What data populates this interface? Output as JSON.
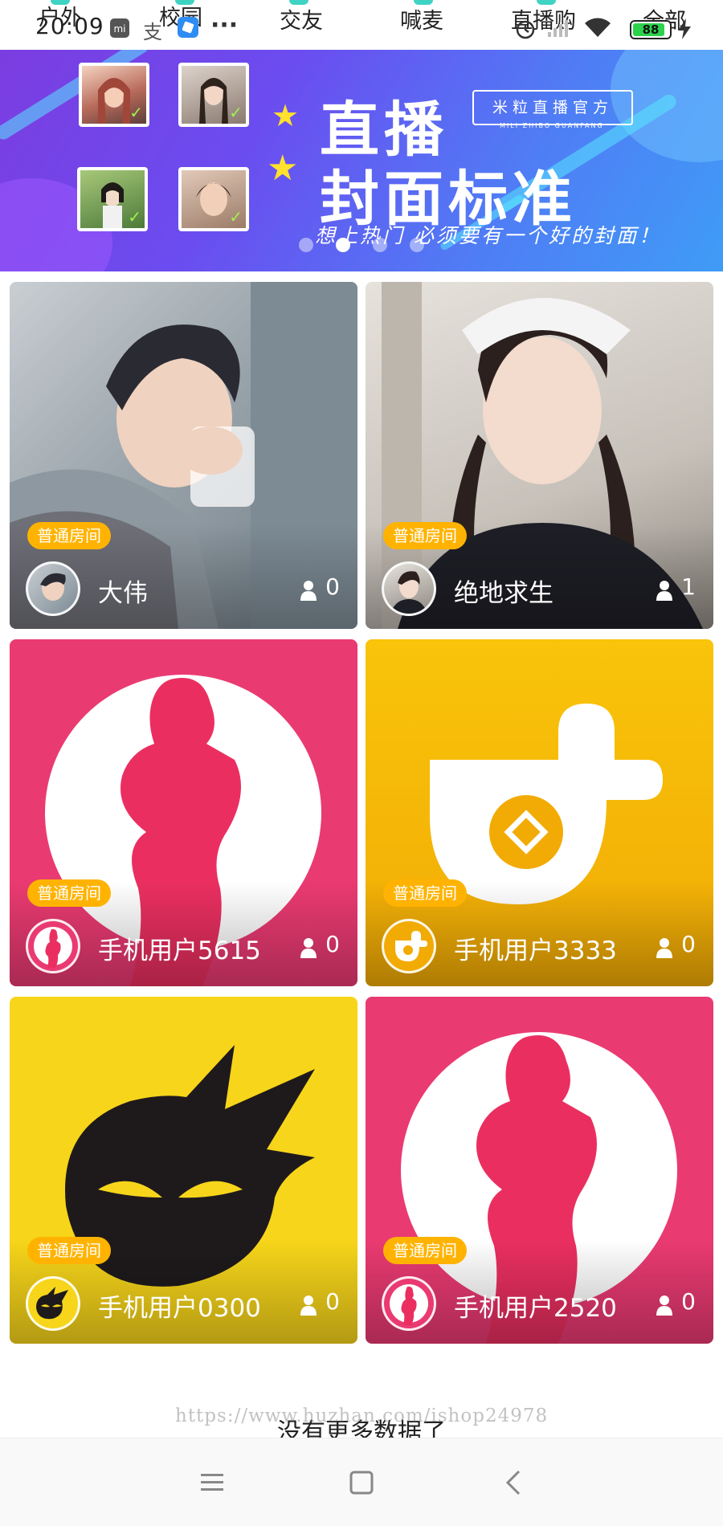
{
  "status_bar": {
    "time": "20:09",
    "more_dots": "···",
    "battery": "88",
    "battery_level": 0.88
  },
  "category_tabs": [
    {
      "label": "户外"
    },
    {
      "label": "校园"
    },
    {
      "label": "交友"
    },
    {
      "label": "喊麦"
    },
    {
      "label": "直播购"
    },
    {
      "label": "全部"
    }
  ],
  "banner": {
    "title_line1": "直播",
    "title_line2": "封面标准",
    "tag": "米粒直播官方",
    "tag_sub": "MILI ZHIBO GUANFANG",
    "slogan": "想上热门 必须要有一个好的封面！",
    "page_count": 4,
    "active_page": 2
  },
  "rooms": [
    {
      "badge": "普通房间",
      "name": "大伟",
      "viewers": "0"
    },
    {
      "badge": "普通房间",
      "name": "绝地求生",
      "viewers": "1"
    },
    {
      "badge": "普通房间",
      "name": "手机用户5615",
      "viewers": "0"
    },
    {
      "badge": "普通房间",
      "name": "手机用户3333",
      "viewers": "0"
    },
    {
      "badge": "普通房间",
      "name": "手机用户0300",
      "viewers": "0"
    },
    {
      "badge": "普通房间",
      "name": "手机用户2520",
      "viewers": "0"
    }
  ],
  "footer": {
    "no_more": "没有更多数据了",
    "watermark": "https://www.huzhan.com/ishop24978"
  },
  "colors": {
    "badge": "#ffb300",
    "pink_card": "#ea3a72",
    "orange_card": "#f7b500",
    "yellow_card": "#f7d51a",
    "banner_start": "#7b3de0",
    "banner_end": "#3f9cf6"
  },
  "icons": {
    "menu": "menu-icon",
    "home": "home-icon",
    "back": "back-icon",
    "viewer": "person-icon"
  }
}
